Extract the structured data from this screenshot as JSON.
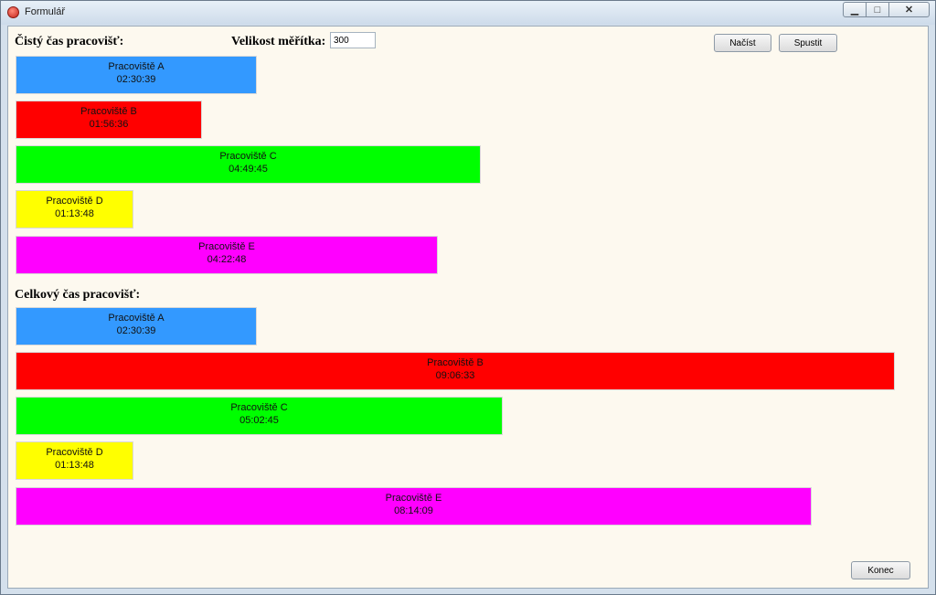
{
  "window": {
    "title": "Formulář",
    "icon": "app-logo-icon"
  },
  "controls": {
    "minimize": "▁",
    "maximize": "□",
    "close": "✕"
  },
  "form": {
    "clean_label": "Čistý čas pracovišť:",
    "scale_label": "Velikost měřítka:",
    "scale_value": "300",
    "load_button": "Načíst",
    "start_button": "Spustit",
    "total_label": "Celkový čas pracovišť:",
    "end_button": "Konec"
  },
  "colors": {
    "A": "#3399ff",
    "B": "#ff0000",
    "C": "#00ff00",
    "D": "#ffff00",
    "E": "#ff00ff"
  },
  "clean_bars": [
    {
      "label": "Pracoviště A",
      "time": "02:30:39",
      "key": "A"
    },
    {
      "label": "Pracoviště B",
      "time": "01:56:36",
      "key": "B"
    },
    {
      "label": "Pracoviště C",
      "time": "04:49:45",
      "key": "C"
    },
    {
      "label": "Pracoviště D",
      "time": "01:13:48",
      "key": "D"
    },
    {
      "label": "Pracoviště E",
      "time": "04:22:48",
      "key": "E"
    }
  ],
  "total_bars": [
    {
      "label": "Pracoviště A",
      "time": "02:30:39",
      "key": "A"
    },
    {
      "label": "Pracoviště B",
      "time": "09:06:33",
      "key": "B"
    },
    {
      "label": "Pracoviště C",
      "time": "05:02:45",
      "key": "C"
    },
    {
      "label": "Pracoviště D",
      "time": "01:13:48",
      "key": "D"
    },
    {
      "label": "Pracoviště E",
      "time": "08:14:09",
      "key": "E"
    }
  ]
}
